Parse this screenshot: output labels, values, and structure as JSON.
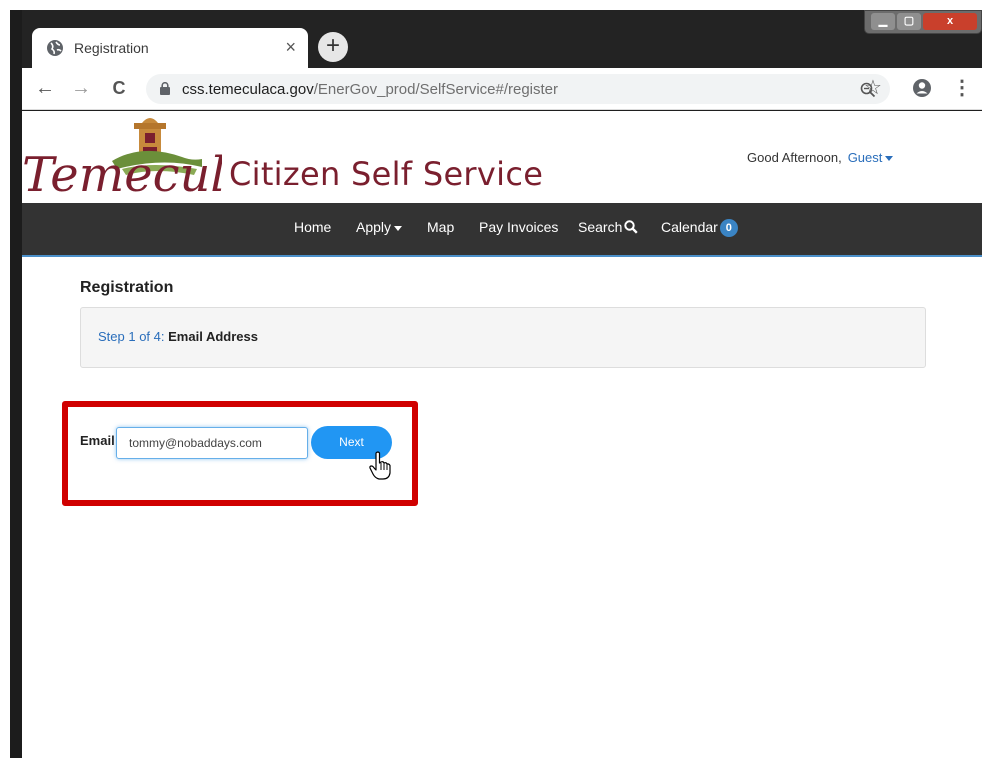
{
  "browser": {
    "tab_title": "Registration",
    "tab_close": "×",
    "new_tab": "+",
    "url_host": "css.temeculaca.gov",
    "url_path": "/EnerGov_prod/SelfService#/register",
    "back": "←",
    "forward": "→",
    "reload": "C",
    "zoom_icon": "zoom-icon",
    "star": "☆",
    "menu": "⋮",
    "window_controls": {
      "minimize": "▁",
      "maximize": "▢",
      "close": "x"
    }
  },
  "header": {
    "logo_text": "Temecula",
    "site_title": "Citizen Self Service",
    "greeting": "Good Afternoon,",
    "user": "Guest"
  },
  "nav": {
    "items": [
      {
        "label": "Home"
      },
      {
        "label": "Apply"
      },
      {
        "label": "Map"
      },
      {
        "label": "Pay Invoices"
      },
      {
        "label": "Search"
      },
      {
        "label": "Calendar"
      }
    ],
    "calendar_count": "0"
  },
  "registration": {
    "title": "Registration",
    "step_num": "Step 1 of 4:",
    "step_label": "Email Address",
    "email_label": "Email",
    "email_value": "tommy@nobaddays.com",
    "next_label": "Next"
  },
  "colors": {
    "brand": "#7a1f2e",
    "navbar": "#333333",
    "accent": "#2196f3",
    "highlight": "#d00000"
  }
}
